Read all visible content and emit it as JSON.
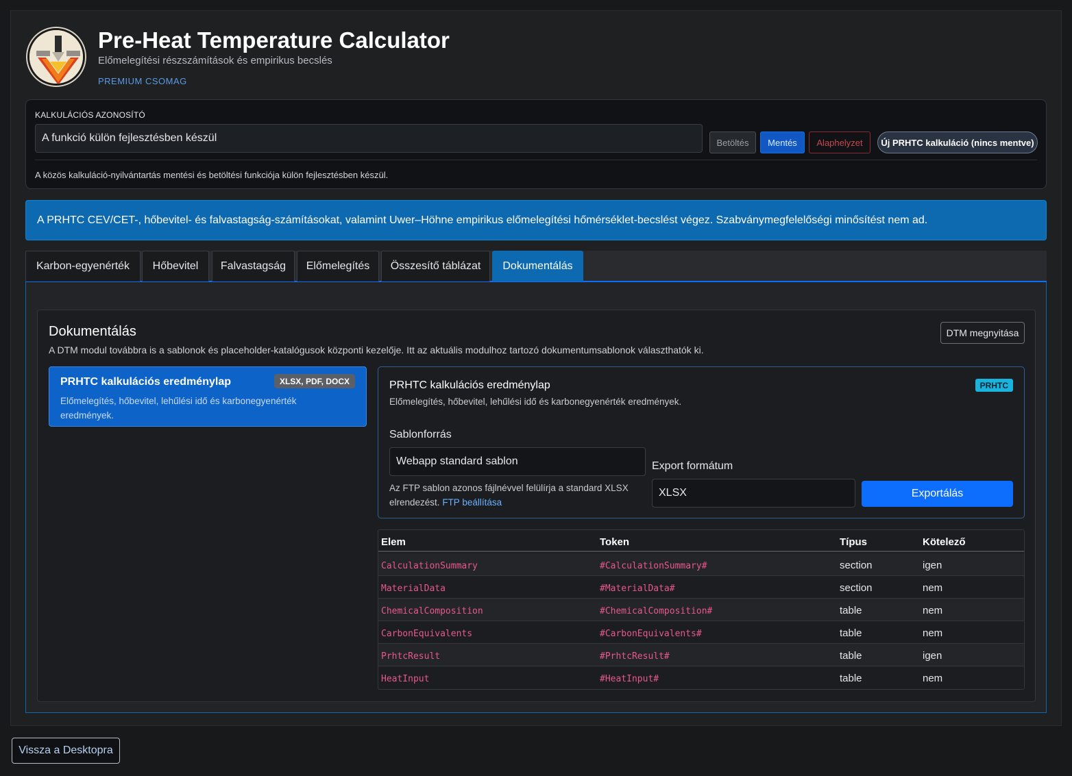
{
  "header": {
    "title": "Pre-Heat Temperature Calculator",
    "subtitle": "Előmelegítési részszámítások és empirikus becslés",
    "plan": "PREMIUM CSOMAG"
  },
  "calc": {
    "label": "KALKULÁCIÓS AZONOSÍTÓ",
    "value": "A funkció külön fejlesztésben készül",
    "load_label": "Betöltés",
    "save_label": "Mentés",
    "reset_label": "Alaphelyzet",
    "new_label": "Új PRHTC kalkuláció (nincs mentve)",
    "note": "A közös kalkuláció-nyilvántartás mentési és betöltési funkciója külön fejlesztésben készül."
  },
  "banner": {
    "text": "A PRHTC CEV/CET-, hőbevitel- és falvastagság-számításokat, valamint Uwer–Höhne empirikus előmelegítési hőmérséklet-becslést végez. Szabványmegfelelőségi minősítést nem ad."
  },
  "tabs": [
    {
      "label": "Karbon-egyenérték"
    },
    {
      "label": "Hőbevitel"
    },
    {
      "label": "Falvastagság"
    },
    {
      "label": "Előmelegítés"
    },
    {
      "label": "Összesítő táblázat"
    },
    {
      "label": "Dokumentálás"
    }
  ],
  "active_tab": "Dokumentálás",
  "doc": {
    "title": "Dokumentálás",
    "description": "A DTM modul továbbra is a sablonok és placeholder-katalógusok központi kezelője. Itt az aktuális modulhoz tartozó dokumentumsablonok választhatók ki.",
    "open_dtm_label": "DTM megnyitása",
    "template": {
      "name": "PRHTC kalkulációs eredménylap",
      "formats": "XLSX, PDF, DOCX",
      "description": "Előmelegítés, hőbevitel, lehűlési idő és karbonegyenérték eredmények."
    },
    "detail": {
      "title": "PRHTC kalkulációs eredménylap",
      "badge": "PRHTC",
      "description": "Előmelegítés, hőbevitel, lehűlési idő és karbonegyenérték eredmények.",
      "source_label": "Sablonforrás",
      "source_value": "Webapp standard sablon",
      "source_help": "Az FTP sablon azonos fájlnévvel felülírja a standard XLSX elrendezést.",
      "source_link": "FTP beállítása",
      "format_label": "Export formátum",
      "format_value": "XLSX",
      "export_label": "Exportálás"
    },
    "table": {
      "headers": [
        "Elem",
        "Token",
        "Típus",
        "Kötelező"
      ],
      "rows": [
        {
          "elem": "CalculationSummary",
          "token": "#CalculationSummary#",
          "type": "section",
          "required": "igen"
        },
        {
          "elem": "MaterialData",
          "token": "#MaterialData#",
          "type": "section",
          "required": "nem"
        },
        {
          "elem": "ChemicalComposition",
          "token": "#ChemicalComposition#",
          "type": "table",
          "required": "nem"
        },
        {
          "elem": "CarbonEquivalents",
          "token": "#CarbonEquivalents#",
          "type": "table",
          "required": "nem"
        },
        {
          "elem": "PrhtcResult",
          "token": "#PrhtcResult#",
          "type": "table",
          "required": "igen"
        },
        {
          "elem": "HeatInput",
          "token": "#HeatInput#",
          "type": "table",
          "required": "nem"
        }
      ]
    }
  },
  "footer": {
    "back_label": "Vissza a Desktopra"
  },
  "colors": {
    "accent": "#0d6efd",
    "banner": "#0d6ab1",
    "token_text": "#e8588f",
    "badge": "#18b4dd"
  }
}
